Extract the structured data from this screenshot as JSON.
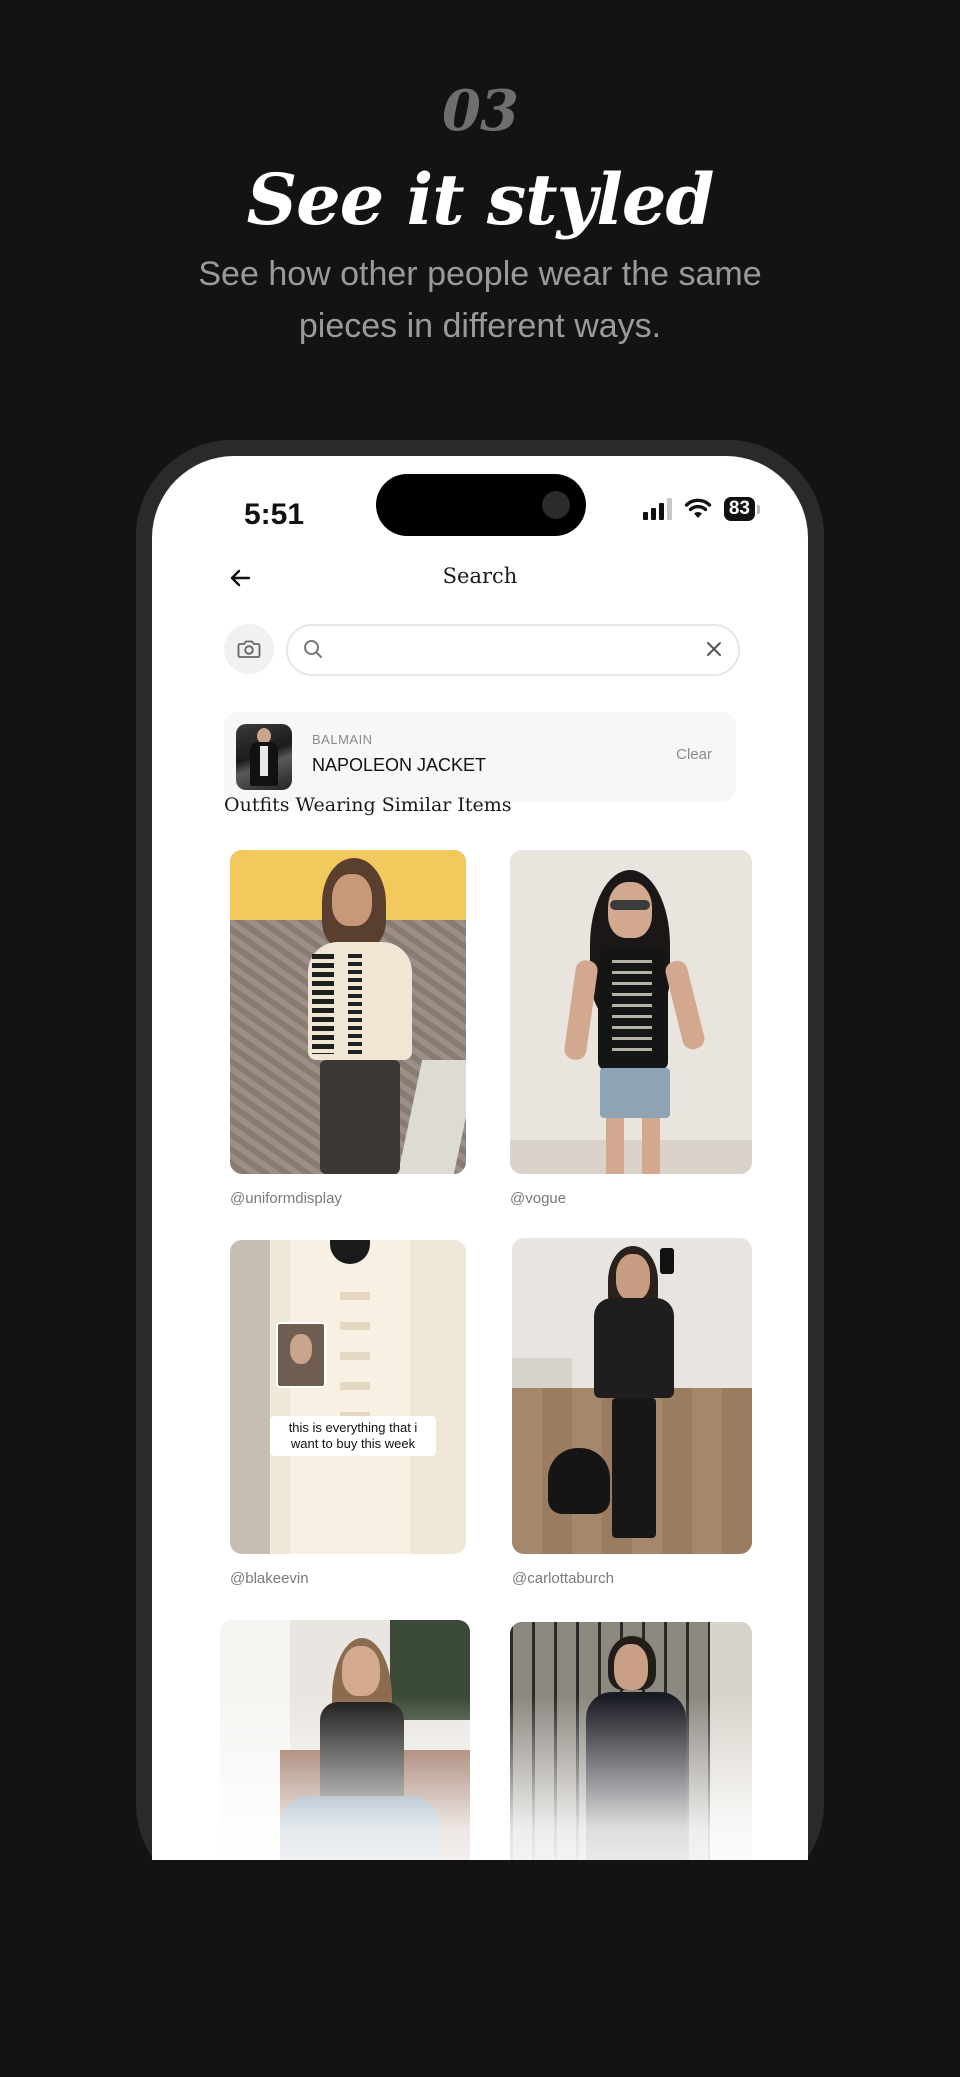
{
  "header": {
    "step_number": "03",
    "headline": "See it styled",
    "subtext": "See how other people wear the same pieces in different ways."
  },
  "status_bar": {
    "time": "5:51",
    "battery": "83",
    "icons": [
      "cellular-signal-icon",
      "wifi-icon",
      "battery-icon"
    ]
  },
  "nav": {
    "back_icon": "arrow-left-icon",
    "title": "Search"
  },
  "search": {
    "camera_icon": "camera-icon",
    "search_icon": "search-icon",
    "value": "",
    "clear_icon": "close-icon"
  },
  "selected_item": {
    "brand": "BALMAIN",
    "name": "NAPOLEON JACKET",
    "clear_label": "Clear"
  },
  "section": {
    "title": "Outfits Wearing Similar Items"
  },
  "outfits": [
    {
      "handle": "@uniformdisplay"
    },
    {
      "handle": "@vogue"
    },
    {
      "handle": "@blakeevin",
      "overlay_caption": "this is everything that i want to buy this week"
    },
    {
      "handle": "@carlottaburch"
    },
    {
      "handle": ""
    },
    {
      "handle": ""
    }
  ],
  "colors": {
    "background": "#131313",
    "headline": "#ffffff",
    "subtext": "#9a9a9a",
    "step_number": "#6e6e6e",
    "screen": "#ffffff"
  }
}
